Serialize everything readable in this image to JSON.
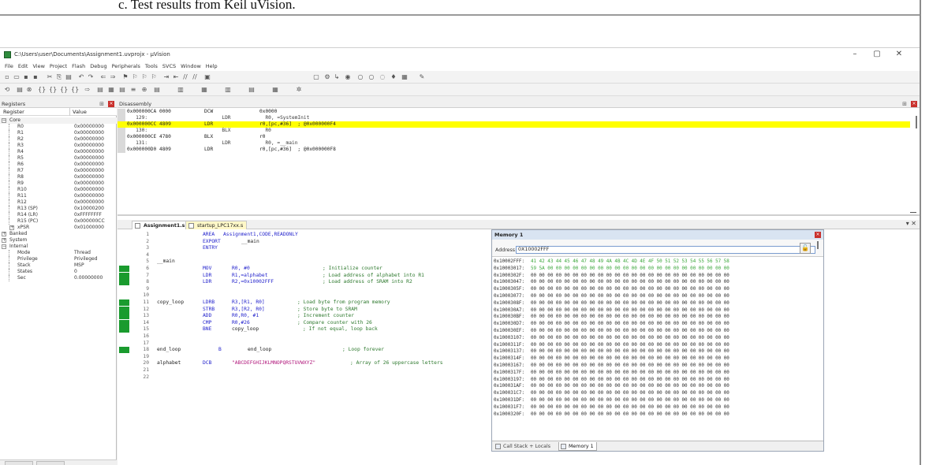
{
  "document": {
    "caption": "c.  Test results from Keil uVision."
  },
  "window": {
    "title": "C:\\Users\\user\\Documents\\Assignment1.uvprojx - µVision",
    "controls": [
      "–",
      "▢",
      "✕"
    ]
  },
  "menu": [
    "File",
    "Edit",
    "View",
    "Project",
    "Flash",
    "Debug",
    "Peripherals",
    "Tools",
    "SVCS",
    "Window",
    "Help"
  ],
  "registers": {
    "title": "Registers",
    "col_register": "Register",
    "col_value": "Value",
    "rows": [
      {
        "name": "Core",
        "value": "",
        "level": 0,
        "exp": "−"
      },
      {
        "name": "R0",
        "value": "0x00000000",
        "level": 1
      },
      {
        "name": "R1",
        "value": "0x00000000",
        "level": 1
      },
      {
        "name": "R2",
        "value": "0x00000000",
        "level": 1
      },
      {
        "name": "R3",
        "value": "0x00000000",
        "level": 1
      },
      {
        "name": "R4",
        "value": "0x00000000",
        "level": 1
      },
      {
        "name": "R5",
        "value": "0x00000000",
        "level": 1
      },
      {
        "name": "R6",
        "value": "0x00000000",
        "level": 1
      },
      {
        "name": "R7",
        "value": "0x00000000",
        "level": 1
      },
      {
        "name": "R8",
        "value": "0x00000000",
        "level": 1
      },
      {
        "name": "R9",
        "value": "0x00000000",
        "level": 1
      },
      {
        "name": "R10",
        "value": "0x00000000",
        "level": 1
      },
      {
        "name": "R11",
        "value": "0x00000000",
        "level": 1
      },
      {
        "name": "R12",
        "value": "0x00000000",
        "level": 1
      },
      {
        "name": "R13 (SP)",
        "value": "0x10000200",
        "level": 1
      },
      {
        "name": "R14 (LR)",
        "value": "0xFFFFFFFF",
        "level": 1
      },
      {
        "name": "R15 (PC)",
        "value": "0x000000CC",
        "level": 1
      },
      {
        "name": "xPSR",
        "value": "0x01000000",
        "level": 1,
        "exp": "+"
      },
      {
        "name": "Banked",
        "value": "",
        "level": 0,
        "exp": "+"
      },
      {
        "name": "System",
        "value": "",
        "level": 0,
        "exp": "+"
      },
      {
        "name": "Internal",
        "value": "",
        "level": 0,
        "exp": "−"
      },
      {
        "name": "Mode",
        "value": "Thread",
        "level": 1
      },
      {
        "name": "Privilege",
        "value": "Privileged",
        "level": 1
      },
      {
        "name": "Stack",
        "value": "MSP",
        "level": 1
      },
      {
        "name": "States",
        "value": "0",
        "level": 1
      },
      {
        "name": "Sec",
        "value": "0.00000000",
        "level": 1
      }
    ]
  },
  "disassembly": {
    "title": "Disassembly",
    "lines": [
      {
        "addr": "0x000000CA 0000",
        "op": "DCW",
        "args": "0x0000",
        "hl": false,
        "src": false
      },
      {
        "addr": "   129:",
        "op": "      LDR",
        "args": "  R0, =SystemInit",
        "hl": false,
        "src": true
      },
      {
        "addr": "0x000000CC 4809",
        "op": "LDR",
        "args": "r0,[pc,#36]  ; @0x000000F4",
        "hl": true,
        "src": false
      },
      {
        "addr": "   130:",
        "op": "      BLX",
        "args": "  R0",
        "hl": false,
        "src": true
      },
      {
        "addr": "0x000000CE 4780",
        "op": "BLX",
        "args": "r0",
        "hl": false,
        "src": false
      },
      {
        "addr": "   131:",
        "op": "      LDR",
        "args": "  R0, =__main",
        "hl": false,
        "src": true
      },
      {
        "addr": "0x000000D0 4809",
        "op": "LDR",
        "args": "r0,[pc,#36]  ; @0x000000F8",
        "hl": false,
        "src": false
      }
    ]
  },
  "editor": {
    "tabs": [
      {
        "label": "Assignment1.s",
        "active": true
      },
      {
        "label": "startup_LPC17xx.s",
        "active": false
      }
    ],
    "lines": [
      {
        "n": "1",
        "mark": false,
        "label": "",
        "op": "AREA",
        "args": "Assignment1,CODE,READONLY",
        "comment": ""
      },
      {
        "n": "2",
        "mark": false,
        "label": "",
        "op": "EXPORT",
        "args": "__main",
        "comment": ""
      },
      {
        "n": "3",
        "mark": false,
        "label": "",
        "op": "ENTRY",
        "args": "",
        "comment": ""
      },
      {
        "n": "4",
        "mark": false,
        "label": "",
        "op": "",
        "args": "",
        "comment": ""
      },
      {
        "n": "5",
        "mark": false,
        "label": "__main",
        "op": "",
        "args": "",
        "comment": ""
      },
      {
        "n": "6",
        "mark": true,
        "label": "",
        "op": "MOV",
        "args": "R0, #0",
        "comment": "; Initialize counter"
      },
      {
        "n": "7",
        "mark": true,
        "label": "",
        "op": "LDR",
        "args": "R1,=alphabet",
        "comment": "; Load address of alphabet into R1"
      },
      {
        "n": "8",
        "mark": true,
        "label": "",
        "op": "LDR",
        "args": "R2,=0x10002FFF",
        "comment": "; Load address of SRAM into R2"
      },
      {
        "n": "9",
        "mark": false,
        "label": "",
        "op": "",
        "args": "",
        "comment": ""
      },
      {
        "n": "10",
        "mark": false,
        "label": "",
        "op": "",
        "args": "",
        "comment": ""
      },
      {
        "n": "11",
        "mark": true,
        "label": "copy_loop",
        "op": "LDRB",
        "args": "R3,[R1, R0]",
        "comment": "; Load byte from program memory"
      },
      {
        "n": "12",
        "mark": true,
        "label": "",
        "op": "STRB",
        "args": "R3,[R2, R0]",
        "comment": "; Store byte to SRAM"
      },
      {
        "n": "13",
        "mark": true,
        "label": "",
        "op": "ADD",
        "args": "R0,R0, #1",
        "comment": "; Increment counter"
      },
      {
        "n": "14",
        "mark": true,
        "label": "",
        "op": "CMP",
        "args": "R0,#26",
        "comment": "; Compare counter with 26"
      },
      {
        "n": "15",
        "mark": true,
        "label": "",
        "op": "BNE",
        "args": "copy_loop",
        "comment": "; If not equal, loop back"
      },
      {
        "n": "16",
        "mark": false,
        "label": "",
        "op": "",
        "args": "",
        "comment": ""
      },
      {
        "n": "17",
        "mark": false,
        "label": "",
        "op": "",
        "args": "",
        "comment": ""
      },
      {
        "n": "18",
        "mark": true,
        "label": "end_loop",
        "op": "B",
        "args": "end_loop",
        "comment": "; Loop forever"
      },
      {
        "n": "19",
        "mark": false,
        "label": "",
        "op": "",
        "args": "",
        "comment": ""
      },
      {
        "n": "20",
        "mark": false,
        "label": "alphabet",
        "op": "DCB",
        "args": "\"ABCDEFGHIJKLMNOPQRSTUVWXYZ\"",
        "comment": "; Array of 26 uppercase letters"
      },
      {
        "n": "21",
        "mark": false,
        "label": "",
        "op": "",
        "args": "",
        "comment": ""
      },
      {
        "n": "22",
        "mark": false,
        "label": "",
        "op": "",
        "args": "",
        "comment": ""
      }
    ]
  },
  "memory": {
    "title": "Memory 1",
    "address_label": "Address:",
    "address_value": "0X10002FFF",
    "rows": [
      {
        "addr": "0x10002FFF:",
        "bytes": "41 42 43 44 45 46 47 48 49 4A 4B 4C 4D 4E 4F 50 51 52 53 54 55 56 57 58",
        "changed": true
      },
      {
        "addr": "0x10003017:",
        "bytes": "59 5A 00 00 00 00 00 00 00 00 00 00 00 00 00 00 00 00 00 00 00 00 00 00",
        "changed": true
      },
      {
        "addr": "0x1000302F:",
        "bytes": "00 00 00 00 00 00 00 00 00 00 00 00 00 00 00 00 00 00 00 00 00 00 00 00",
        "changed": false
      },
      {
        "addr": "0x10003047:",
        "bytes": "00 00 00 00 00 00 00 00 00 00 00 00 00 00 00 00 00 00 00 00 00 00 00 00",
        "changed": false
      },
      {
        "addr": "0x1000305F:",
        "bytes": "00 00 00 00 00 00 00 00 00 00 00 00 00 00 00 00 00 00 00 00 00 00 00 00",
        "changed": false
      },
      {
        "addr": "0x10003077:",
        "bytes": "00 00 00 00 00 00 00 00 00 00 00 00 00 00 00 00 00 00 00 00 00 00 00 00",
        "changed": false
      },
      {
        "addr": "0x1000308F:",
        "bytes": "00 00 00 00 00 00 00 00 00 00 00 00 00 00 00 00 00 00 00 00 00 00 00 00",
        "changed": false
      },
      {
        "addr": "0x100030A7:",
        "bytes": "00 00 00 00 00 00 00 00 00 00 00 00 00 00 00 00 00 00 00 00 00 00 00 00",
        "changed": false
      },
      {
        "addr": "0x100030BF:",
        "bytes": "00 00 00 00 00 00 00 00 00 00 00 00 00 00 00 00 00 00 00 00 00 00 00 00",
        "changed": false
      },
      {
        "addr": "0x100030D7:",
        "bytes": "00 00 00 00 00 00 00 00 00 00 00 00 00 00 00 00 00 00 00 00 00 00 00 00",
        "changed": false
      },
      {
        "addr": "0x100030EF:",
        "bytes": "00 00 00 00 00 00 00 00 00 00 00 00 00 00 00 00 00 00 00 00 00 00 00 00",
        "changed": false
      },
      {
        "addr": "0x10003107:",
        "bytes": "00 00 00 00 00 00 00 00 00 00 00 00 00 00 00 00 00 00 00 00 00 00 00 00",
        "changed": false
      },
      {
        "addr": "0x1000311F:",
        "bytes": "00 00 00 00 00 00 00 00 00 00 00 00 00 00 00 00 00 00 00 00 00 00 00 00",
        "changed": false
      },
      {
        "addr": "0x10003137:",
        "bytes": "00 00 00 00 00 00 00 00 00 00 00 00 00 00 00 00 00 00 00 00 00 00 00 00",
        "changed": false
      },
      {
        "addr": "0x1000314F:",
        "bytes": "00 00 00 00 00 00 00 00 00 00 00 00 00 00 00 00 00 00 00 00 00 00 00 00",
        "changed": false
      },
      {
        "addr": "0x10003167:",
        "bytes": "00 00 00 00 00 00 00 00 00 00 00 00 00 00 00 00 00 00 00 00 00 00 00 00",
        "changed": false
      },
      {
        "addr": "0x1000317F:",
        "bytes": "00 00 00 00 00 00 00 00 00 00 00 00 00 00 00 00 00 00 00 00 00 00 00 00",
        "changed": false
      },
      {
        "addr": "0x10003197:",
        "bytes": "00 00 00 00 00 00 00 00 00 00 00 00 00 00 00 00 00 00 00 00 00 00 00 00",
        "changed": false
      },
      {
        "addr": "0x100031AF:",
        "bytes": "00 00 00 00 00 00 00 00 00 00 00 00 00 00 00 00 00 00 00 00 00 00 00 00",
        "changed": false
      },
      {
        "addr": "0x100031C7:",
        "bytes": "00 00 00 00 00 00 00 00 00 00 00 00 00 00 00 00 00 00 00 00 00 00 00 00",
        "changed": false
      },
      {
        "addr": "0x100031DF:",
        "bytes": "00 00 00 00 00 00 00 00 00 00 00 00 00 00 00 00 00 00 00 00 00 00 00 00",
        "changed": false
      },
      {
        "addr": "0x100031F7:",
        "bytes": "00 00 00 00 00 00 00 00 00 00 00 00 00 00 00 00 00 00 00 00 00 00 00 00",
        "changed": false
      },
      {
        "addr": "0x1000320F:",
        "bytes": "00 00 00 00 00 00 00 00 00 00 00 00 00 00 00 00 00 00 00 00 00 00 00 00",
        "changed": false
      }
    ],
    "tabs": [
      {
        "label": "Call Stack + Locals",
        "active": false
      },
      {
        "label": "Memory 1",
        "active": true
      }
    ]
  },
  "colors": {
    "pc_highlight": "#ffff00",
    "breakpoint_mark": "#1a9b2e",
    "changed_bytes": "#3aa63a"
  }
}
